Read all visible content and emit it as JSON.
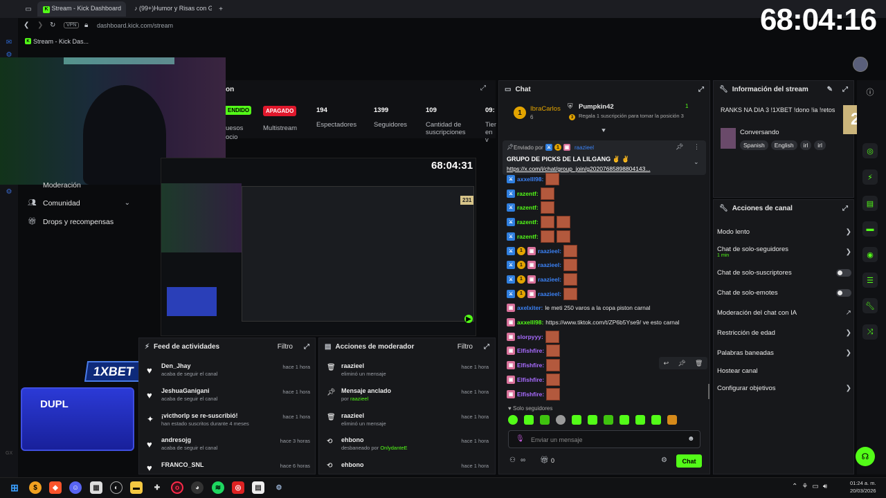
{
  "browser": {
    "tabs": [
      {
        "label": "Stream - Kick Dashboard"
      },
      {
        "label": "(99+)Humor y Risas con G"
      }
    ],
    "url": "dashboard.kick.com/stream",
    "vpn": "VPN",
    "bookmark": "Stream - Kick Das..."
  },
  "overlay": {
    "timer": "68:04:16",
    "inner_timer": "68:04:31",
    "viewer_badge": "231",
    "brand": "1XBET",
    "promo_text": "DUPL"
  },
  "stats": {
    "title_partial": "on",
    "status_pill": "ENDIDO",
    "multistream_pill": "APAGADO",
    "multistream_label": "Multistream",
    "items": [
      {
        "value": "194",
        "label": "Espectadores"
      },
      {
        "value": "1399",
        "label": "Seguidores"
      },
      {
        "value": "109",
        "label": "Cantidad de suscripciones"
      },
      {
        "value": "09:",
        "label": "Tiem en v"
      }
    ],
    "left_partial_1": "uesos",
    "left_partial_2": "ocio"
  },
  "nav": {
    "moderation": "Moderación",
    "community": "Comunidad",
    "drops": "Drops y recompensas"
  },
  "feed": {
    "title": "Feed de actividades",
    "filter": "Filtro",
    "items": [
      {
        "name": "Den_Jhay",
        "desc": "acaba de seguir el canal",
        "time": "hace 1 hora"
      },
      {
        "name": "JeshuaGanigani",
        "desc": "acaba de seguir el canal",
        "time": "hace 1 hora"
      },
      {
        "name": "¡victhorlp se re-suscribió!",
        "desc": "han estado suscritos durante 4 meses",
        "time": "hace 1 hora"
      },
      {
        "name": "andresojg",
        "desc": "acaba de seguir el canal",
        "time": "hace 3 horas"
      },
      {
        "name": "FRANCO_SNL",
        "desc": "",
        "time": "hace 6 horas"
      }
    ]
  },
  "modactions": {
    "title": "Acciones de moderador",
    "filter": "Filtro",
    "items": [
      {
        "name": "raazieel",
        "desc": "eliminó un mensaje",
        "highlight": "",
        "time": "hace 1 hora"
      },
      {
        "name": "Mensaje anclado",
        "desc": "por",
        "highlight": "raazieel",
        "time": "hace 1 hora"
      },
      {
        "name": "raazieel",
        "desc": "eliminó un mensaje",
        "highlight": "",
        "time": "hace 1 hora"
      },
      {
        "name": "ehbono",
        "desc": "desbaneado por",
        "highlight": "OnlydanteE",
        "time": "hace 1 hora"
      },
      {
        "name": "ehbono",
        "desc": "",
        "highlight": "",
        "time": "hace 1 hora"
      }
    ]
  },
  "chat": {
    "title": "Chat",
    "top_gifter_1": {
      "name": "IbraCarlos",
      "count": "6"
    },
    "top_gifter_2": {
      "name": "Pumpkin42",
      "note": "Regala 1 suscripción para tomar la posición 3",
      "count": "1"
    },
    "pinned": {
      "sent_by": "Enviado por",
      "user": "raazieel",
      "text": "GRUPO DE PICKS DE LA LILGANG ✌ ✌",
      "link": "https://x.com/i/chat/group_join/g20207685898804143..."
    },
    "messages": [
      {
        "user": "axxelll98:",
        "text": "",
        "color": "#3b82f6",
        "emotes": 1
      },
      {
        "user": "razentf:",
        "text": "",
        "color": "#53fc18",
        "emotes": 1
      },
      {
        "user": "razentf:",
        "text": "",
        "color": "#53fc18",
        "emotes": 1
      },
      {
        "user": "razentf:",
        "text": "",
        "color": "#53fc18",
        "emotes": 2
      },
      {
        "user": "razentf:",
        "text": "",
        "color": "#53fc18",
        "emotes": 2
      },
      {
        "user": "raazieel:",
        "text": "",
        "color": "#3b82f6",
        "emotes": 1
      },
      {
        "user": "raazieel:",
        "text": "",
        "color": "#3b82f6",
        "emotes": 1
      },
      {
        "user": "raazieel:",
        "text": "",
        "color": "#3b82f6",
        "emotes": 1
      },
      {
        "user": "raazieel:",
        "text": "",
        "color": "#3b82f6",
        "emotes": 1
      },
      {
        "user": "axelxiter:",
        "text": "le meti 250 varos a la copa piston carnal",
        "color": "#3b82f6",
        "emotes": 0
      },
      {
        "user": "axxelll98:",
        "text": "https://www.tiktok.com/t/ZP6b5Yse9/ ve esto carnal",
        "color": "#53fc18",
        "emotes": 0
      },
      {
        "user": "slorpyyy:",
        "text": "",
        "color": "#a86bff",
        "emotes": 1
      },
      {
        "user": "Elfishfire:",
        "text": "",
        "color": "#a86bff",
        "emotes": 1
      },
      {
        "user": "Elfishfire:",
        "text": "",
        "color": "#a86bff",
        "emotes": 1
      },
      {
        "user": "Elfishfire:",
        "text": "",
        "color": "#a86bff",
        "emotes": 1
      },
      {
        "user": "Elfishfire:",
        "text": "",
        "color": "#a86bff",
        "emotes": 1
      }
    ],
    "followers_only": "Solo seguidores",
    "placeholder": "Enviar un mensaje",
    "points": "0",
    "send": "Chat"
  },
  "stream_info": {
    "title": "Información del stream",
    "stream_title": "RANKS NA DIA 3 !1XBET !dono !ia !retos",
    "category": "Conversando",
    "tags": [
      "Spanish",
      "English",
      "irl",
      "irl"
    ]
  },
  "channel_actions": {
    "title": "Acciones de canal",
    "items": [
      {
        "label": "Modo lento",
        "sub": "",
        "control": "chevron"
      },
      {
        "label": "Chat de solo-seguidores",
        "sub": "1 min",
        "control": "chevron"
      },
      {
        "label": "Chat de solo-suscriptores",
        "sub": "",
        "control": "toggle"
      },
      {
        "label": "Chat de solo-emotes",
        "sub": "",
        "control": "toggle"
      },
      {
        "label": "Moderación del chat con IA",
        "sub": "",
        "control": "external"
      },
      {
        "label": "Restricción de edad",
        "sub": "",
        "control": "chevron"
      },
      {
        "label": "Palabras baneadas",
        "sub": "",
        "control": "chevron"
      },
      {
        "label": "Hostear canal",
        "sub": "",
        "control": "none"
      },
      {
        "label": "Configurar objetivos",
        "sub": "",
        "control": "chevron"
      }
    ]
  },
  "taskbar": {
    "time": "01:24 a. m.",
    "date": "20/03/2026"
  },
  "colors": {
    "accent": "#53fc18",
    "danger": "#e0182c",
    "panel": "#17181b"
  }
}
